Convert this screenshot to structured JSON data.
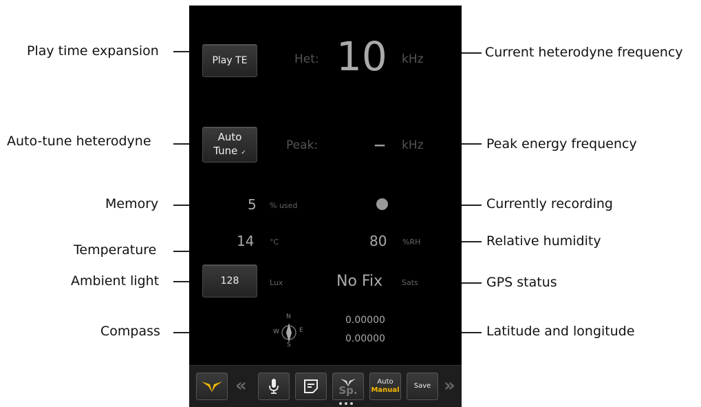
{
  "callouts": {
    "play_te": "Play time expansion",
    "auto_tune": "Auto-tune heterodyne",
    "memory": "Memory",
    "temperature": "Temperature",
    "ambient_light": "Ambient light",
    "compass": "Compass",
    "het_freq": "Current heterodyne frequency",
    "peak_freq": "Peak energy frequency",
    "recording": "Currently recording",
    "humidity": "Relative humidity",
    "gps": "GPS status",
    "latlon": "Latitude and longitude"
  },
  "app": {
    "play_te_label": "Play TE",
    "auto_line1": "Auto",
    "auto_line2": "Tune",
    "auto_check": "✓",
    "het_label": "Het:",
    "het_value": "10",
    "het_unit": "kHz",
    "peak_label": "Peak:",
    "peak_value": "–",
    "peak_unit": "kHz",
    "memory_value": "5",
    "memory_unit": "% used",
    "temp_value": "14",
    "temp_unit": "°C",
    "humidity_value": "80",
    "humidity_unit": "%RH",
    "light_value": "128",
    "light_unit": "Lux",
    "gps_status": "No Fix",
    "gps_unit": "Sats",
    "latitude": "0.00000",
    "longitude": "0.00000",
    "compass": {
      "n": "N",
      "e": "E",
      "s": "S",
      "w": "W"
    }
  },
  "toolbar": {
    "species_label": "Sp.",
    "auto_label": "Auto",
    "manual_label": "Manual",
    "save_label": "Save",
    "icons": [
      "logo-icon",
      "chevron-left-icon",
      "microphone-icon",
      "notes-icon",
      "species-icon",
      "chevron-right-icon"
    ],
    "colors": {
      "accent": "#f5b800",
      "manual": "#f5b800"
    }
  }
}
